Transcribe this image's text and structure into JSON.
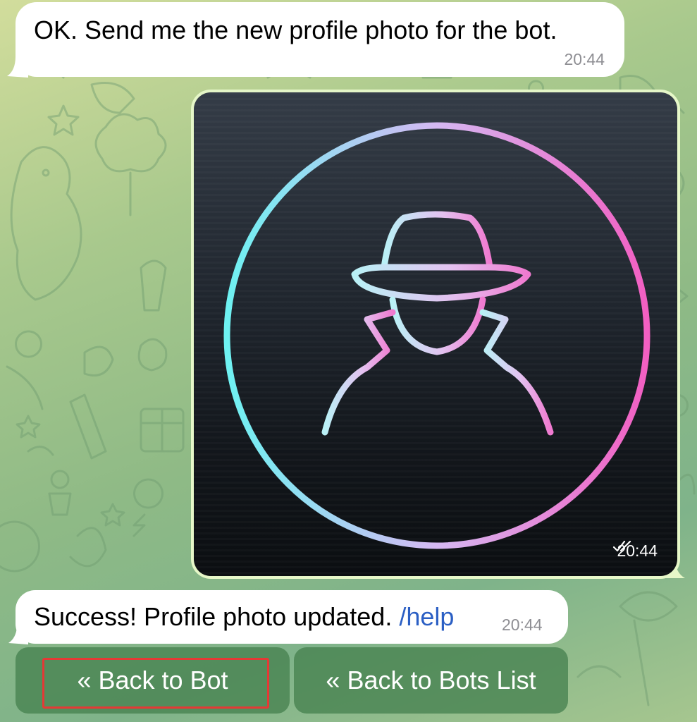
{
  "messages": [
    {
      "text": "OK. Send me the new profile photo for the bot.",
      "time": "20:44"
    },
    {
      "photo_time": "20:44",
      "status_icon": "double-check-icon"
    },
    {
      "text": "Success! Profile photo updated.",
      "command": "/help",
      "time": "20:44"
    }
  ],
  "keyboard": {
    "back_to_bot": "« Back to Bot",
    "back_to_bots_list": "« Back to Bots List"
  },
  "colors": {
    "bubble": "#ffffff",
    "photo_frame": "#e6f7c8",
    "command_link": "#2b5fc4",
    "keyboard_button": "#4e8a5a",
    "highlight": "#e53935",
    "ring_start": "#6ef2f2",
    "ring_end": "#f25fc2"
  },
  "photo_subject": "spy-silhouette-icon"
}
